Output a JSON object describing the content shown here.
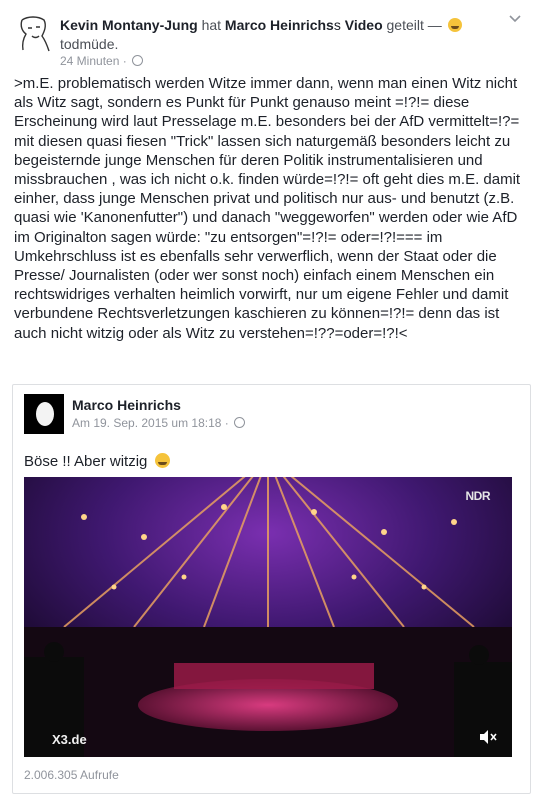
{
  "post": {
    "author": "Kevin Montany-Jung",
    "shared_prefix": "hat",
    "shared_name": "Marco Heinrichs",
    "shared_object": "Video",
    "shared_suffix": "geteilt —",
    "feeling": "todmüde.",
    "time": "24 Minuten",
    "text": ">m.E. problematisch werden Witze immer dann, wenn man einen Witz nicht als Witz sagt, sondern es Punkt für Punkt genauso meint =!?!= diese Erscheinung wird laut Presselage m.E.  besonders bei der AfD vermittelt=!?= mit diesen quasi fiesen  \"Trick\" lassen sich naturgemäß besonders leicht zu begeisternde junge Menschen für deren Politik instrumentalisieren und missbrauchen , was ich nicht o.k. finden würde=!?!= oft geht dies m.E. damit einher,  dass junge Menschen privat und politisch  nur aus- und benutzt  (z.B. quasi wie 'Kanonenfutter\") und danach \"weggeworfen\" werden oder wie AfD im Originalton sagen würde: \"zu entsorgen\"=!?!= oder=!?!=== im Umkehrschluss ist es ebenfalls sehr verwerflich, wenn der Staat oder die Presse/ Journalisten (oder wer sonst noch) einfach einem Menschen ein rechtswidriges verhalten heimlich vorwirft, nur um eigene Fehler und damit verbundene Rechtsverletzungen kaschieren zu können=!?!= denn das ist auch nicht witzig oder als Witz zu verstehen=!??=oder=!?!<"
  },
  "shared_card": {
    "name": "Marco Heinrichs",
    "date": "Am 19. Sep. 2015 um 18:18 ·",
    "text": "Böse !! Aber witzig",
    "video": {
      "logo_top": "NDR",
      "logo_bottom": "X3.de"
    },
    "views": "2.006.305 Aufrufe"
  },
  "colors": {
    "text": "#1d2129",
    "meta": "#90949c",
    "border": "#dddfe2"
  },
  "icons": [
    "author-avatar-icon",
    "chevron-down-icon",
    "globe-icon",
    "mute-icon",
    "feeling-emoji-icon",
    "wink-emoji-icon"
  ]
}
